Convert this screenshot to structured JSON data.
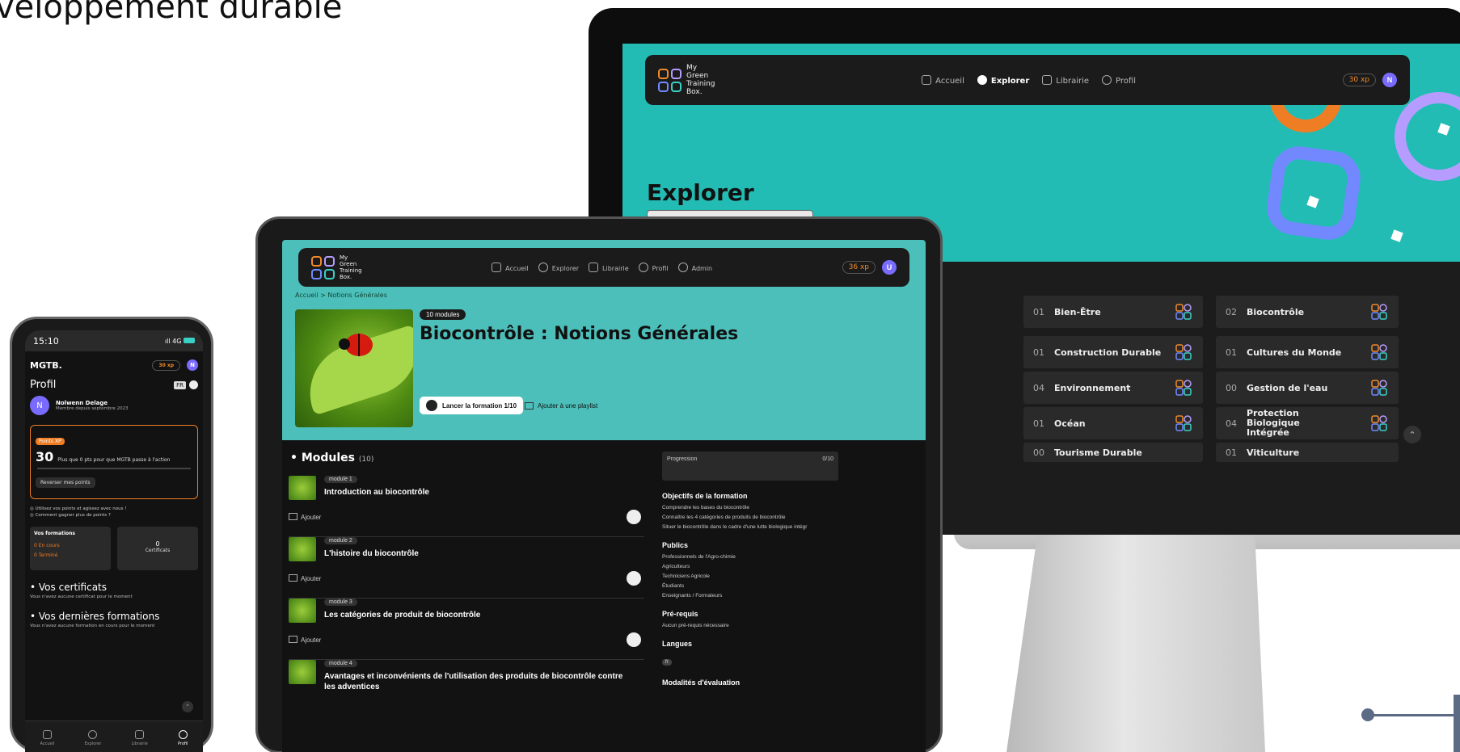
{
  "slide_title": "veloppement durable",
  "brand": {
    "line1": "My",
    "line2": "Green",
    "line3": "Training",
    "line4": "Box."
  },
  "desktop": {
    "nav": {
      "items": [
        "Accueil",
        "Explorer",
        "Librairie",
        "Profil"
      ],
      "active": "Explorer",
      "xp": "30 xp",
      "avatar": "N"
    },
    "page_title": "Explorer",
    "categories": [
      {
        "num": "01",
        "label": "Bien-Être"
      },
      {
        "num": "02",
        "label": "Biocontrôle"
      },
      {
        "num": "01",
        "label": "Construction Durable"
      },
      {
        "num": "01",
        "label": "Cultures du Monde"
      },
      {
        "num": "04",
        "label": "Environnement"
      },
      {
        "num": "00",
        "label": "Gestion de l'eau"
      },
      {
        "num": "01",
        "label": "Océan"
      },
      {
        "num": "04",
        "label": "Protection Biologique Intégrée"
      },
      {
        "num": "00",
        "label": "Tourisme Durable"
      },
      {
        "num": "01",
        "label": "Viticulture"
      }
    ],
    "partial_label": "ble"
  },
  "tablet": {
    "nav": {
      "items": [
        "Accueil",
        "Explorer",
        "Librairie",
        "Profil",
        "Admin"
      ],
      "xp": "36 xp",
      "avatar": "U"
    },
    "breadcrumb": "Accueil  >  Notions Générales",
    "badge": "10 modules",
    "title": "Biocontrôle : Notions Générales",
    "launch": "Lancer la formation  1/10",
    "add_playlist": "Ajouter à une playlist",
    "modules_heading": "Modules",
    "modules_count": "(10)",
    "modules": [
      {
        "tag": "module 1",
        "title": "Introduction au biocontrôle",
        "add": "Ajouter"
      },
      {
        "tag": "module 2",
        "title": "L'histoire du biocontrôle",
        "add": "Ajouter"
      },
      {
        "tag": "module 3",
        "title": "Les catégories de produit de biocontrôle",
        "add": "Ajouter"
      },
      {
        "tag": "module 4",
        "title": "Avantages et inconvénients de l'utilisation des produits de biocontrôle contre les adventices",
        "add": ""
      }
    ],
    "progress": {
      "label": "Progression",
      "value": "0/10"
    },
    "objectives_h": "Objectifs de la formation",
    "objectives": [
      "Comprendre les bases du biocontrôle",
      "Connaître les 4 catégories de produits de biocontrôle",
      "Situer le biocontrôle dans le cadre d'une lutte biologique intégr"
    ],
    "publics_h": "Publics",
    "publics": [
      "Professionnels de l'Agro-chimie",
      "Agriculteurs",
      "Techniciens Agricole",
      "Étudiants",
      "Enseignants / Formateurs"
    ],
    "prereq_h": "Pré-requis",
    "prereq": "Aucun pré-requis nécessaire",
    "langs_h": "Langues",
    "lang": "fr",
    "eval_h": "Modalités d'évaluation"
  },
  "phone": {
    "time": "15:10",
    "signal": "4G",
    "brand": "MGTB.",
    "xp": "30 xp",
    "avatar": "N",
    "title": "Profil",
    "lang": "FR",
    "user_name": "Nolwenn Delage",
    "user_member": "Membre depuis septembre 2023",
    "xp_tag": "Points XP",
    "xp_value": "30",
    "xp_text": "Plus que 0 pts pour que MGTB passe à l'action",
    "reverse": "Reverser mes points",
    "tip1": "Utilisez vos points et agissez avec nous !",
    "tip2": "Comment gagner plus de points ?",
    "formations_h": "Vos formations",
    "en_cours": "0  En cours",
    "termine": "0  Terminé",
    "cert_count": "0",
    "cert_label": "Certificats",
    "certs_h": "Vos certificats",
    "certs_empty": "Vous n'avez aucune certificat pour le moment",
    "last_h": "Vos dernières formations",
    "last_empty": "Vous n'avez aucune formation en cours pour le moment",
    "tabs": [
      "Accueil",
      "Explorer",
      "Librairie",
      "Profil"
    ]
  }
}
